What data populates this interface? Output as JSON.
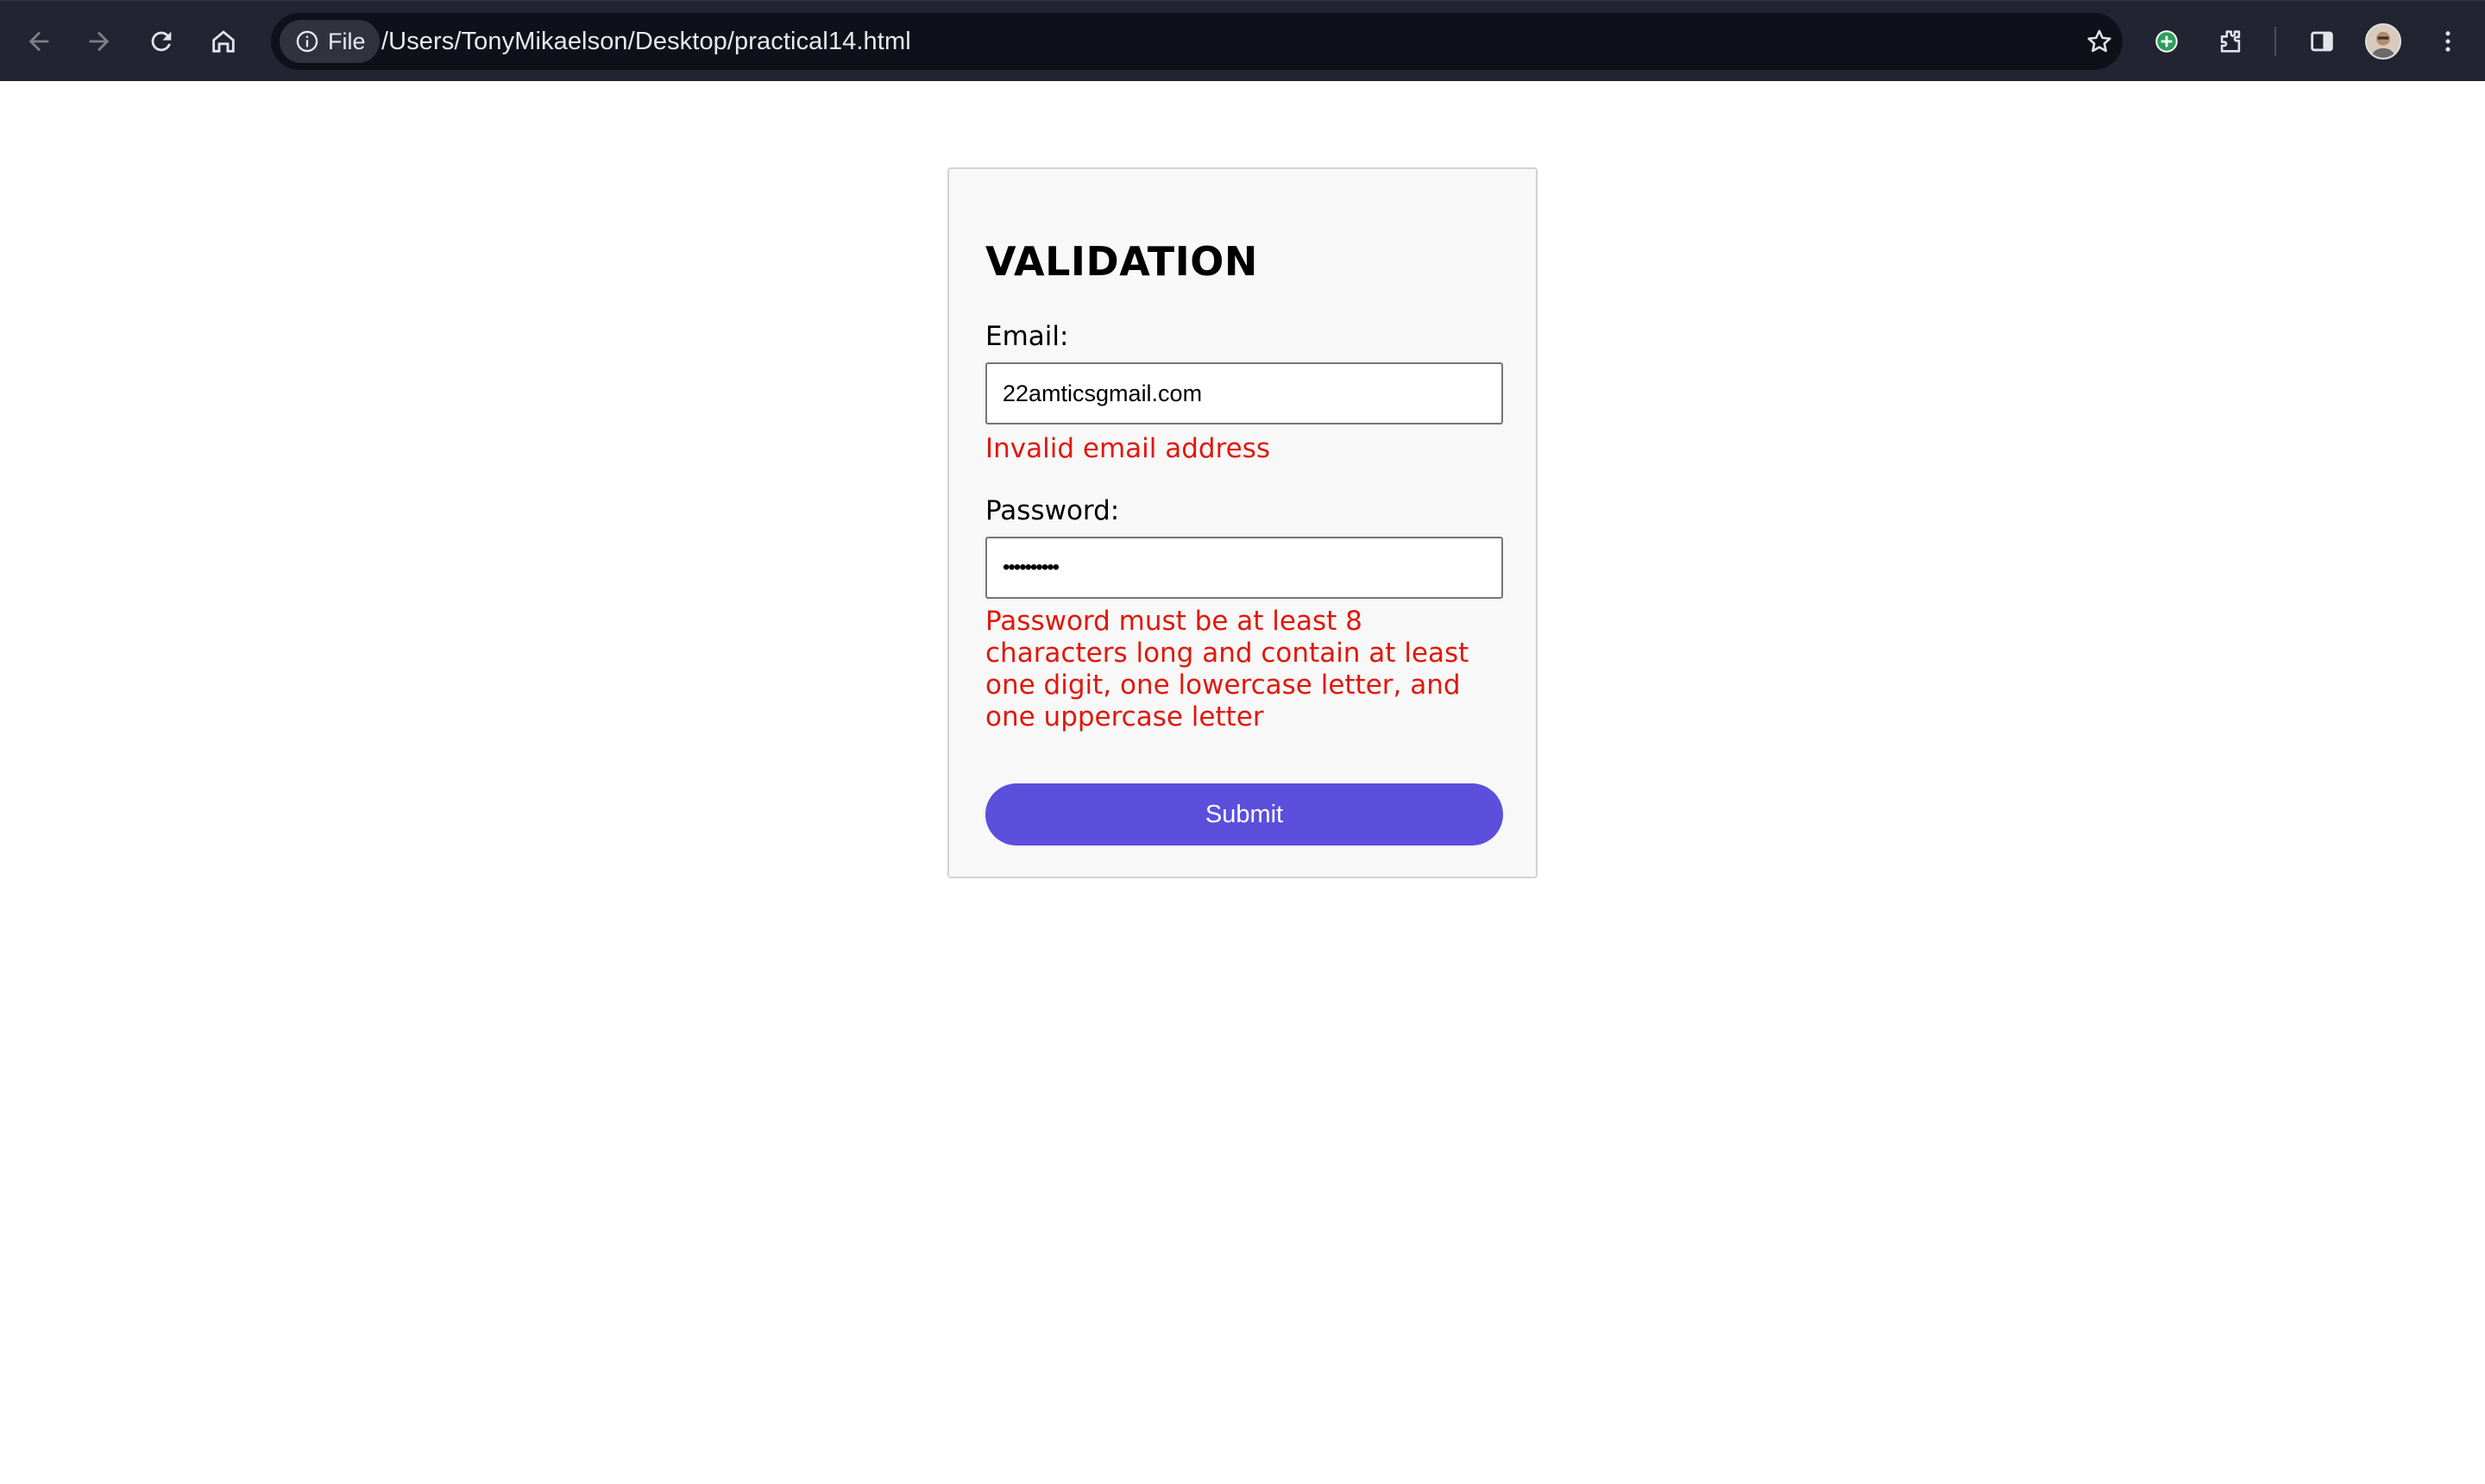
{
  "browser": {
    "chip_label": "File",
    "url": "/Users/TonyMikaelson/Desktop/practical14.html"
  },
  "form": {
    "title": "VALIDATION",
    "email_label": "Email:",
    "email_value": "22amticsgmail.com",
    "email_error": "Invalid email address",
    "password_label": "Password:",
    "password_value": "••••••••••",
    "password_error": "Password must be at least 8 characters long and contain at least one digit, one lowercase letter, and one uppercase letter",
    "submit_label": "Submit"
  },
  "colors": {
    "toolbar_bg": "#222432",
    "omnibox_bg": "#0f111a",
    "error_text": "#e0180b",
    "submit_bg": "#5b4fdc",
    "card_bg": "#f8f8f8"
  }
}
